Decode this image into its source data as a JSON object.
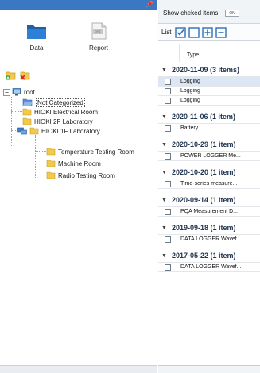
{
  "left": {
    "modes": [
      {
        "label": "Data",
        "icon": "folder-icon"
      },
      {
        "label": "Report",
        "icon": "pdf-icon"
      }
    ],
    "tree": {
      "root": "root",
      "nodes": [
        {
          "label": "Not Categorized",
          "selected": true
        },
        {
          "label": "HIOKI Electrical Room"
        },
        {
          "label": "HIOKI 2F Laboratory"
        },
        {
          "label": "HIOKI 1F Laboratory",
          "expanded": true
        },
        {
          "label": "Temperature Testing Room"
        },
        {
          "label": "Machine Room"
        },
        {
          "label": "Radio Testing Room"
        }
      ]
    }
  },
  "right": {
    "show_checked_label": "Show cheked items",
    "show_checked_button": "ON",
    "list_label": "List",
    "column_type": "Type",
    "groups": [
      {
        "title": "2020-11-09 (3 items)",
        "items": [
          "Logging",
          "Logging",
          "Logging"
        ]
      },
      {
        "title": "2020-11-06 (1 item)",
        "items": [
          "Battery"
        ]
      },
      {
        "title": "2020-10-29 (1 item)",
        "items": [
          "POWER LOGGER Me..."
        ]
      },
      {
        "title": "2020-10-20 (1 item)",
        "items": [
          "Time-series measure..."
        ]
      },
      {
        "title": "2020-09-14 (1 item)",
        "items": [
          "PQA Measurement D..."
        ]
      },
      {
        "title": "2019-09-18 (1 item)",
        "items": [
          "DATA LOGGER Wavef..."
        ]
      },
      {
        "title": "2017-05-22 (1 item)",
        "items": [
          "DATA LOGGER Wavef..."
        ]
      }
    ]
  },
  "colors": {
    "title_bar": "#3b78c4",
    "folder": "#f2c94c",
    "accent_blue": "#2f6fb8",
    "highlight": "#dce6f4"
  }
}
